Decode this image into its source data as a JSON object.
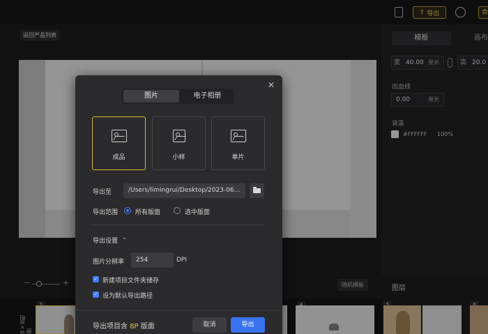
{
  "topbar": {
    "export_label": "导出",
    "more_label": "合"
  },
  "canvas": {
    "back_label": "返回产品列表"
  },
  "bottom": {
    "random_template_label": "随机模板",
    "strip_label": "8×8相册",
    "thumb_numbers": [
      "1",
      "4",
      "5",
      "6"
    ]
  },
  "right_panel": {
    "tab_template": "模板",
    "tab_canvas": "画布",
    "width_label": "宽",
    "width_value": "40.00",
    "width_unit": "厘米",
    "height_label": "高",
    "height_value": "20.0",
    "bleed_label": "出血线",
    "bleed_value": "0.00",
    "bleed_unit": "厘米",
    "background_label": "背景",
    "background_hex": "#FFFFFF",
    "background_opacity": "100%",
    "layers_label": "图层"
  },
  "dialog": {
    "tabs": [
      "图片",
      "电子相册"
    ],
    "options": [
      "成品",
      "小样",
      "单片"
    ],
    "export_to_label": "导出至",
    "export_path": "/Users/limingrui/Desktop/2023-06...",
    "range_label": "导出范围",
    "range_all": "所有版面",
    "range_selected": "选中版面",
    "settings_label": "导出设置",
    "resolution_label": "图片分辨率",
    "resolution_value": "254",
    "resolution_unit": "DPI",
    "checkbox_new_folder": "新建项目文件夹储存",
    "checkbox_default_path": "设为默认导出路径",
    "summary_prefix": "导出项目含",
    "summary_count": "8P",
    "summary_suffix": "版面",
    "cancel_label": "取消",
    "export_label": "导出"
  },
  "colors": {
    "accent_blue": "#3a73ef",
    "accent_gold": "#d9b93c"
  }
}
